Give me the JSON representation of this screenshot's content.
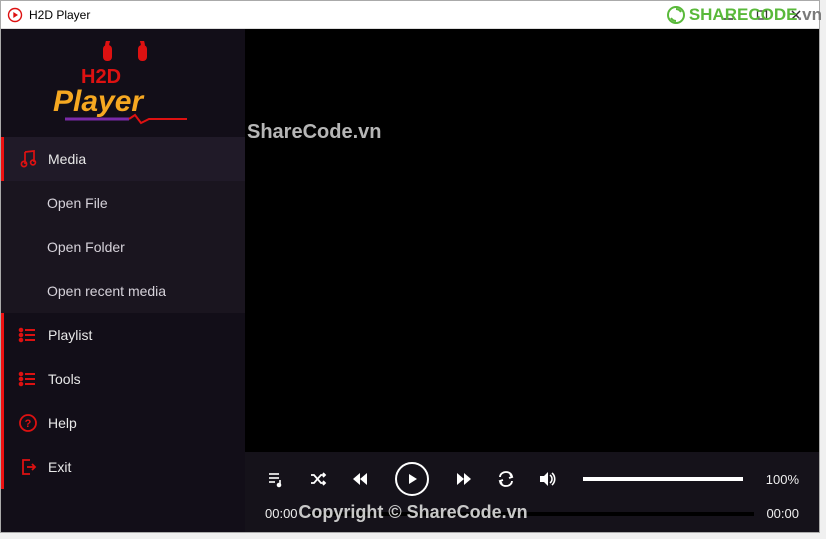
{
  "window": {
    "title": "H2D Player"
  },
  "logo": {
    "line1": "H2D",
    "line2": "Player"
  },
  "sidebar": {
    "media": {
      "label": "Media",
      "items": [
        "Open File",
        "Open Folder",
        "Open recent media"
      ]
    },
    "playlist": {
      "label": "Playlist"
    },
    "tools": {
      "label": "Tools"
    },
    "help": {
      "label": "Help"
    },
    "exit": {
      "label": "Exit"
    }
  },
  "controls": {
    "volume_percent": "100%",
    "time_current": "00:00",
    "time_total": "00:00"
  },
  "watermarks": {
    "top": "ShareCode.vn",
    "bottom": "Copyright © ShareCode.vn",
    "corner_brand": "SHARECODE",
    "corner_tld": ".vn"
  }
}
